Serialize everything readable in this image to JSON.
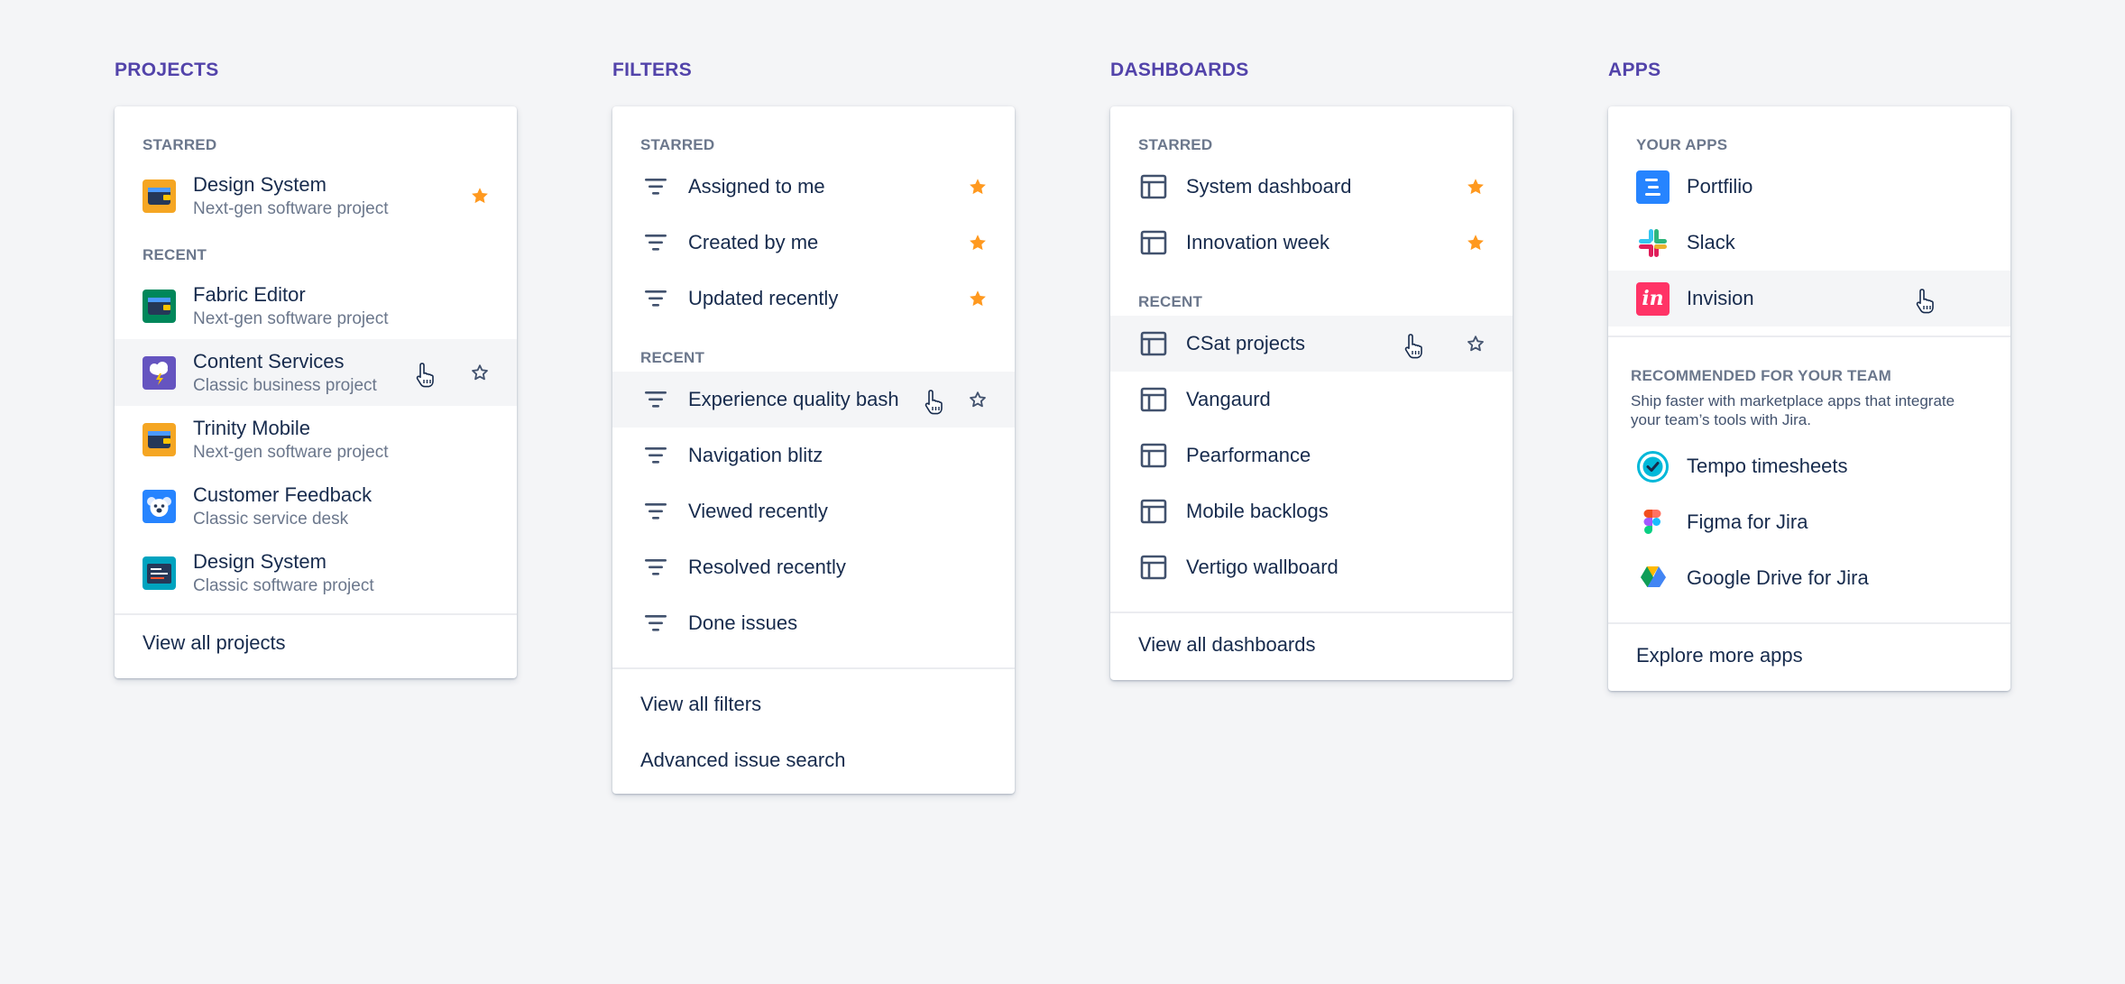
{
  "projects": {
    "title": "PROJECTS",
    "starred_label": "STARRED",
    "starred": [
      {
        "name": "Design System",
        "type": "Next-gen software project",
        "icon": "wallet-icon",
        "color": "#f5a623"
      }
    ],
    "recent_label": "RECENT",
    "recent": [
      {
        "name": "Fabric Editor",
        "type": "Next-gen software project",
        "icon": "wallet-icon",
        "color": "#00875a"
      },
      {
        "name": "Content Services",
        "type": "Classic business project",
        "icon": "cloud-bolt-icon",
        "color": "#6554c0"
      },
      {
        "name": "Trinity Mobile",
        "type": "Next-gen software project",
        "icon": "wallet-icon",
        "color": "#f5a623"
      },
      {
        "name": "Customer Feedback",
        "type": "Classic service desk",
        "icon": "koala-icon",
        "color": "#2684ff"
      },
      {
        "name": "Design System",
        "type": "Classic software project",
        "icon": "screen-icon",
        "color": "#00a3bf"
      }
    ],
    "footer": "View all projects"
  },
  "filters": {
    "title": "FILTERS",
    "starred_label": "STARRED",
    "starred": [
      "Assigned to me",
      "Created by me",
      "Updated recently"
    ],
    "recent_label": "RECENT",
    "recent": [
      "Experience quality bash",
      "Navigation blitz",
      "Viewed recently",
      "Resolved recently",
      "Done issues"
    ],
    "footer": [
      "View all filters",
      "Advanced issue search"
    ]
  },
  "dashboards": {
    "title": "DASHBOARDS",
    "starred_label": "STARRED",
    "starred": [
      "System dashboard",
      "Innovation week"
    ],
    "recent_label": "RECENT",
    "recent": [
      "CSat projects",
      "Vangaurd",
      "Pearformance",
      "Mobile backlogs",
      "Vertigo wallboard"
    ],
    "footer": "View all dashboards"
  },
  "apps": {
    "title": "APPS",
    "your_label": "YOUR APPS",
    "your_apps": [
      {
        "name": "Portfilio",
        "icon": "portfolio-icon",
        "color": "#2684ff"
      },
      {
        "name": "Slack",
        "icon": "slack-icon",
        "color": "#4a154b"
      },
      {
        "name": "Invision",
        "icon": "invision-icon",
        "color": "#ff3366"
      }
    ],
    "recommended_label": "RECOMMENDED FOR YOUR TEAM",
    "recommended_desc_1": "Ship faster with marketplace apps that integrate",
    "recommended_desc_2": "your team’s tools with Jira.",
    "recommended": [
      {
        "name": "Tempo timesheets",
        "icon": "tempo-icon"
      },
      {
        "name": "Figma for Jira",
        "icon": "figma-icon"
      },
      {
        "name": "Google Drive for Jira",
        "icon": "google-drive-icon"
      }
    ],
    "footer": "Explore more apps"
  },
  "colors": {
    "accent": "#5243aa",
    "star": "#ff991f",
    "text": "#172b4d",
    "subtext": "#6b778c",
    "hover": "#f4f5f7"
  }
}
